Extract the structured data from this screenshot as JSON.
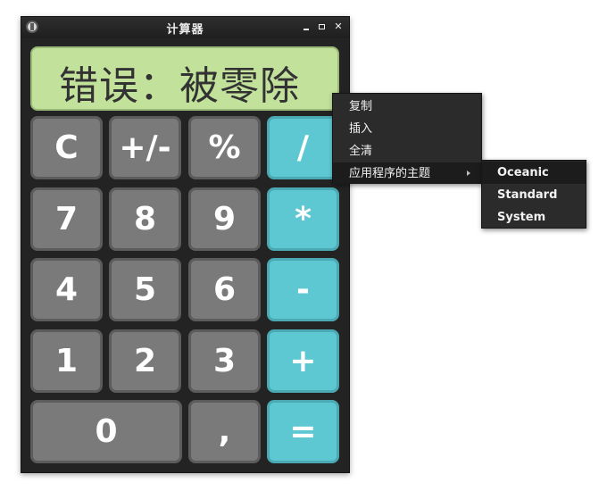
{
  "window": {
    "title": "计算器"
  },
  "display": {
    "text": "错误：被零除"
  },
  "keys": {
    "clear": "C",
    "negate": "+/-",
    "percent": "%",
    "divide": "/",
    "seven": "7",
    "eight": "8",
    "nine": "9",
    "multiply": "*",
    "four": "4",
    "five": "5",
    "six": "6",
    "subtract": "-",
    "one": "1",
    "two": "2",
    "three": "3",
    "add": "+",
    "zero": "0",
    "decimal": ",",
    "equals": "="
  },
  "context_menu": {
    "items": [
      "复制",
      "插入",
      "全清",
      "应用程序的主题"
    ]
  },
  "theme_submenu": {
    "items": [
      "Oceanic",
      "Standard",
      "System"
    ]
  },
  "colors": {
    "display_bg": "#c2e19b",
    "number_key": "#7a7a7a",
    "operator_key": "#5ec8d2",
    "window_bg": "#232323"
  }
}
